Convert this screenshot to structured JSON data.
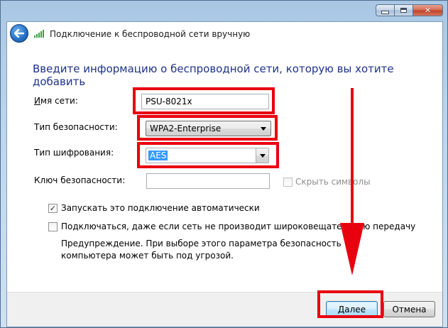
{
  "window": {
    "title": "Подключение к беспроводной сети вручную",
    "caption_buttons": {
      "minimize_icon": "minimize-icon",
      "maximize_icon": "maximize-icon",
      "close_icon": "close-icon"
    },
    "back_icon": "back-arrow-icon",
    "network_icon": "wireless-signal-icon"
  },
  "form": {
    "heading": "Введите информацию о беспроводной сети, которую вы хотите добавить",
    "network_name": {
      "label": "Имя сети:",
      "value": "PSU-8021x"
    },
    "security_type": {
      "label": "Тип безопасности:",
      "value": "WPA2-Enterprise"
    },
    "encryption_type": {
      "label": "Тип шифрования:",
      "value": "AES"
    },
    "security_key": {
      "label": "Ключ безопасности:",
      "value": ""
    },
    "hide_characters": {
      "label": "Скрыть символы",
      "checked": false,
      "enabled": false
    },
    "auto_connect": {
      "label": "Запускать это подключение автоматически",
      "checked": true
    },
    "connect_hidden": {
      "label": "Подключаться, даже если сеть не производит широковещательную передачу",
      "checked": false
    },
    "warning": "Предупреждение. При выборе этого параметра безопасность компьютера может быть под угрозой."
  },
  "buttons": {
    "next": "Далее",
    "cancel": "Отмена"
  },
  "colors": {
    "annotation": "#e8000f",
    "heading": "#1e3287"
  }
}
